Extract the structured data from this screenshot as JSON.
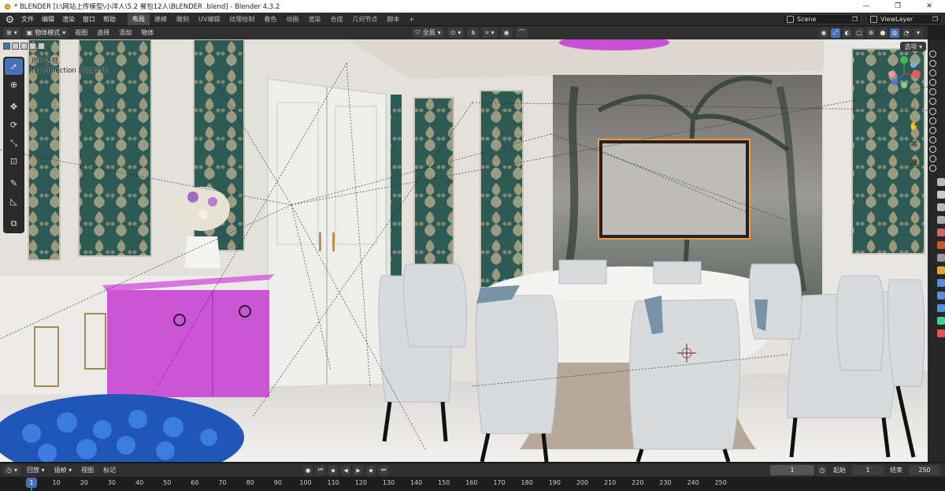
{
  "window": {
    "title": "* BLENDER  [I:\\网站上传模型\\小洋人\\5.2 餐包12人\\BLENDER .blend] - Blender 4.3.2"
  },
  "menu": [
    "文件",
    "编辑",
    "渲染",
    "窗口",
    "帮助"
  ],
  "workspaces": [
    "布局",
    "建模",
    "雕刻",
    "UV编辑",
    "纹理绘制",
    "着色",
    "动画",
    "渲染",
    "合成",
    "几何节点",
    "脚本"
  ],
  "active_workspace": "布局",
  "scene": {
    "label": "Scene"
  },
  "view_layer": {
    "label": "ViewLayer"
  },
  "viewport_header": {
    "mode": "物体模式",
    "menus": [
      "视图",
      "选择",
      "添加",
      "物体"
    ],
    "transform_orientation": "全局"
  },
  "viewport": {
    "view_name": "用户透视",
    "collection_path": "(1) Collection | Box010",
    "options_label": "选项"
  },
  "timeline": {
    "menus": [
      "回放",
      "插帧",
      "视图",
      "标记"
    ],
    "current_frame": "1",
    "start_label": "起始",
    "start_value": "1",
    "end_label": "结束",
    "end_value": "250",
    "ruler_frames": [
      "1",
      "10",
      "20",
      "30",
      "40",
      "50",
      "60",
      "70",
      "80",
      "90",
      "100",
      "110",
      "120",
      "130",
      "140",
      "150",
      "160",
      "170",
      "180",
      "190",
      "200",
      "210",
      "220",
      "230",
      "240",
      "250"
    ]
  },
  "colors": {
    "accent": "#4772b3",
    "selected_object": "#cc55d6"
  },
  "icons": [
    "blender-logo",
    "minimize-icon",
    "maximize-icon",
    "close-icon",
    "select-box-icon",
    "cursor-icon",
    "move-icon",
    "rotate-icon",
    "scale-icon",
    "transform-icon",
    "annotate-icon",
    "measure-icon",
    "add-cube-icon",
    "zoom-icon",
    "pan-hand-icon",
    "camera-icon",
    "grid-icon",
    "eye-icon"
  ]
}
